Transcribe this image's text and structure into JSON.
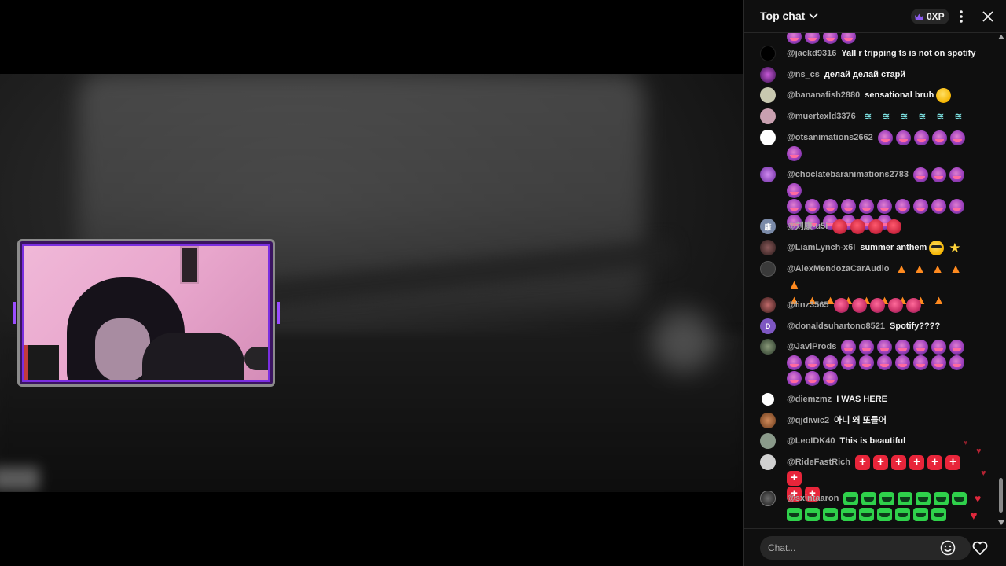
{
  "chat": {
    "title": "Top chat",
    "xp": "0XP",
    "input_placeholder": "Chat...",
    "messages": [
      {
        "author": "@jackd9316",
        "text": "Yall r tripping ts is not on spotify",
        "avatar_color": "#000000"
      },
      {
        "author": "@ns_cs",
        "text": "делай делай старй",
        "avatar_color": "#6a2a8a"
      },
      {
        "author": "@bananafish2880",
        "text": "sensational bruh",
        "avatar_color": "#c8c8b0"
      },
      {
        "author": "@muertexld3376",
        "text": "",
        "avatar_color": "#c9a0b0"
      },
      {
        "author": "@otsanimations2662",
        "text": "",
        "avatar_color": "#ffffff"
      },
      {
        "author": "@choclatebaranimations2783",
        "text": "",
        "avatar_color": "#a04ad0"
      },
      {
        "author": "@刘康-u5i",
        "text": "",
        "avatar_color": "#7a8aa8",
        "avatar_letter": "康"
      },
      {
        "author": "@LiamLynch-x6l",
        "text": "summer anthem",
        "avatar_color": "#5a3a3a"
      },
      {
        "author": "@AlexMendozaCarAudio",
        "text": "",
        "avatar_color": "#3a3a3a"
      },
      {
        "author": "@linz3565",
        "text": "",
        "avatar_color": "#8a3a3a"
      },
      {
        "author": "@donaldsuhartono8521",
        "text": "Spotify????",
        "avatar_color": "#7e57c2",
        "avatar_letter": "D"
      },
      {
        "author": "@JaviProds",
        "text": "",
        "avatar_color": "#4a5a4a"
      },
      {
        "author": "@diemzmz",
        "text": "I WAS HERE",
        "avatar_color": "#ffffff"
      },
      {
        "author": "@qjdiwic2",
        "text": "아니 왜 또들어",
        "avatar_color": "#b06a3a"
      },
      {
        "author": "@LeoIDK40",
        "text": "This is beautiful",
        "avatar_color": "#8a9a8a"
      },
      {
        "author": "@RideFastRich",
        "text": "",
        "avatar_color": "#d0d0d0"
      },
      {
        "author": "@sxintaaron",
        "text": "",
        "avatar_color": "#2a2a2a"
      }
    ]
  },
  "icons": {
    "chevron": "chevron-down-icon",
    "crown": "crown-icon",
    "kebab": "more-vert-icon",
    "close": "close-icon",
    "emoji": "emoji-icon",
    "like": "heart-icon"
  },
  "colors": {
    "chat_bg": "#0f0f0f",
    "accent_purple": "#7a2ee0",
    "heart_red": "#e0283c"
  }
}
